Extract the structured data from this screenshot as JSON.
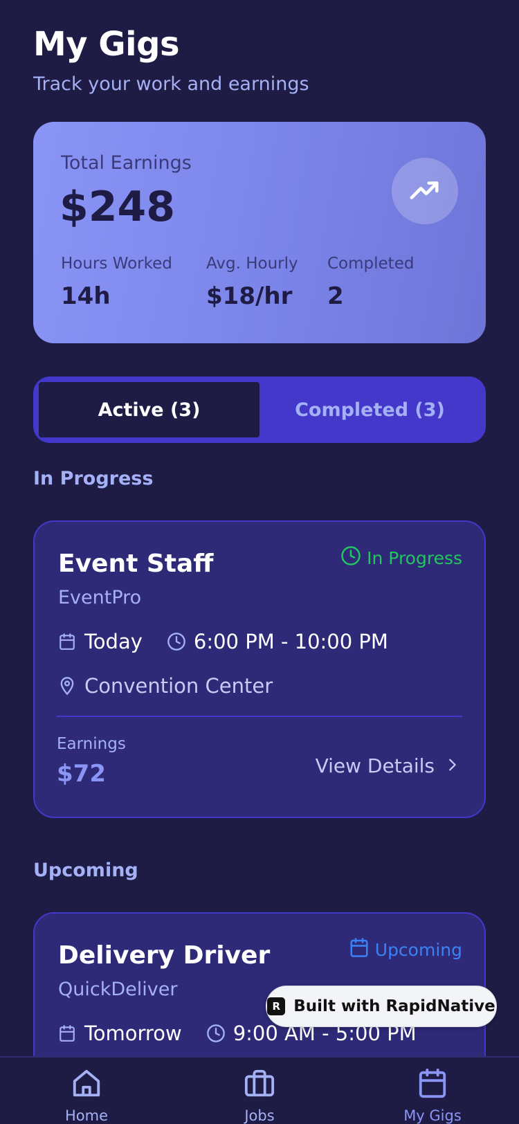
{
  "header": {
    "title": "My Gigs",
    "subtitle": "Track your work and earnings"
  },
  "earnings": {
    "label": "Total Earnings",
    "value": "$248",
    "icon": "trending-up-icon",
    "stats": [
      {
        "label": "Hours Worked",
        "value": "14h"
      },
      {
        "label": "Avg. Hourly",
        "value": "$18/hr"
      },
      {
        "label": "Completed",
        "value": "2"
      }
    ]
  },
  "tabs": [
    {
      "label": "Active (3)",
      "active": true
    },
    {
      "label": "Completed (3)",
      "active": false
    }
  ],
  "sections": {
    "in_progress": "In Progress",
    "upcoming": "Upcoming"
  },
  "gigs": [
    {
      "title": "Event Staff",
      "company": "EventPro",
      "status": "In Progress",
      "status_color": "#22c55e",
      "date": "Today",
      "time": "6:00 PM - 10:00 PM",
      "location": "Convention Center",
      "earnings_label": "Earnings",
      "earnings": "$72",
      "details_label": "View Details"
    },
    {
      "title": "Delivery Driver",
      "company": "QuickDeliver",
      "status": "Upcoming",
      "status_color": "#3b82f6",
      "date": "Tomorrow",
      "time": "9:00 AM - 5:00 PM"
    }
  ],
  "badge": {
    "label": "Built with RapidNative"
  },
  "nav": [
    {
      "label": "Home",
      "icon": "home-icon",
      "active": false
    },
    {
      "label": "Jobs",
      "icon": "briefcase-icon",
      "active": false
    },
    {
      "label": "My Gigs",
      "icon": "calendar-icon",
      "active": true
    }
  ],
  "colors": {
    "background": "#1e1b45",
    "card": "#2e2a78",
    "accent": "#4338ca",
    "earnings_gradient_start": "#8a95f6",
    "earnings_gradient_end": "#6e75d8",
    "text_muted": "#a5b1f5"
  }
}
